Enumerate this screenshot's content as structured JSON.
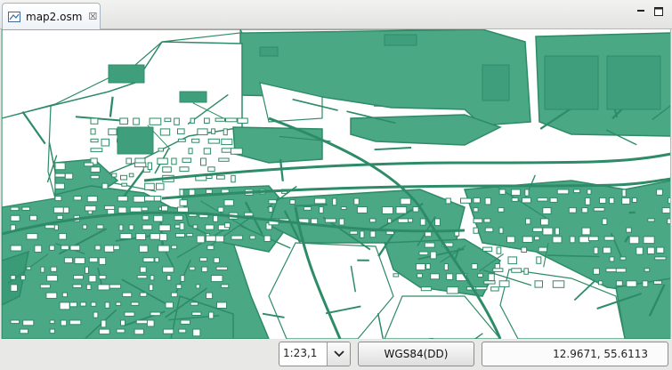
{
  "editor_tab": {
    "title": "map2.osm",
    "icon": "map-file-icon",
    "close_icon": "close-icon"
  },
  "window_controls": {
    "minimize_icon": "minimize-icon",
    "maximize_icon": "maximize-icon"
  },
  "map": {
    "land_color": "#3f9f7c",
    "road_color": "#2e8b68",
    "water_color": "#ffffff"
  },
  "statusbar": {
    "scale": "1:23,1",
    "scale_dropdown_icon": "chevron-down-icon",
    "crs_label": "WGS84(DD)",
    "coordinates": "12.9671, 55.6113"
  }
}
